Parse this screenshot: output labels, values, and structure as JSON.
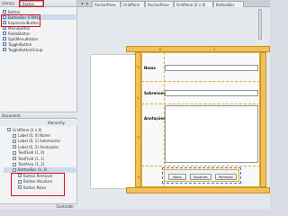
{
  "library": {
    "title": "Library",
    "search_value": "Button",
    "items": [
      {
        "label": "Button"
      },
      {
        "label": "ButtonBar  (FXML)"
      },
      {
        "label": "ExpansionButton"
      },
      {
        "label": "MenuButton"
      },
      {
        "label": "RadioButton"
      },
      {
        "label": "SplitMenuButton"
      },
      {
        "label": "ToggleButton"
      },
      {
        "label": "ToggleButtonGroup"
      }
    ]
  },
  "document": {
    "title": "Document",
    "hierarchy_tab": "Hierarchy",
    "tree": [
      {
        "label": "GridPane  (2 x 4)"
      },
      {
        "label": "Label (0, 0)  Nome"
      },
      {
        "label": "Label (0, 1)  Sobrenome"
      },
      {
        "label": "Label (0, 2)  Anotações"
      },
      {
        "label": "TextField (1, 0)"
      },
      {
        "label": "TextField (1, 1)"
      },
      {
        "label": "TextArea (1, 2)"
      },
      {
        "label": "ButtonBar (1, 3)"
      },
      {
        "label": "Button  Remover"
      },
      {
        "label": "Button  Atualizar"
      },
      {
        "label": "Button  Novo"
      }
    ],
    "controller_label": "Controller"
  },
  "tabs": [
    {
      "label": "AnchorPane"
    },
    {
      "label": "GridPane"
    },
    {
      "label": "AnchorPane"
    },
    {
      "label": "GridPane (2 x 4)"
    },
    {
      "label": "ButtonBar"
    }
  ],
  "form": {
    "labels": [
      "Nome",
      "Sobrenome",
      "Anotações"
    ],
    "buttons": [
      "Novo",
      "Atualizar",
      "Remover"
    ]
  },
  "grid_guides": {
    "columns": [
      "0",
      "1"
    ],
    "rows": [
      "0",
      "1",
      "2",
      "3"
    ]
  }
}
